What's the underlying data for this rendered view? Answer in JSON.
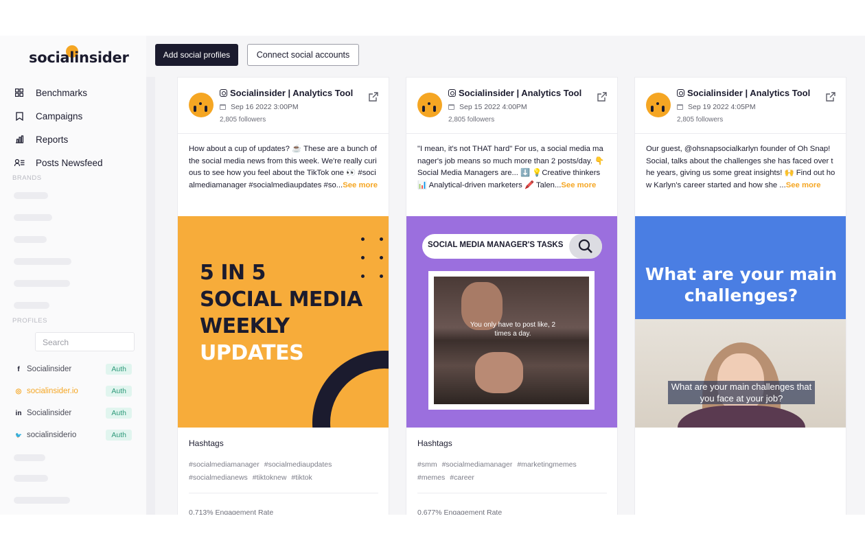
{
  "brand": {
    "logo_text": "socialinsider",
    "accent": "#f5a623",
    "dark": "#1b1b2e"
  },
  "nav": {
    "items": [
      {
        "label": "Benchmarks",
        "icon": "grid-icon"
      },
      {
        "label": "Campaigns",
        "icon": "bookmark-icon"
      },
      {
        "label": "Reports",
        "icon": "bar-chart-icon"
      },
      {
        "label": "Posts Newsfeed",
        "icon": "user-list-icon"
      }
    ]
  },
  "sections": {
    "brands": "BRANDS",
    "profiles": "PROFILES"
  },
  "search": {
    "placeholder": "Search"
  },
  "profiles": [
    {
      "icon": "f",
      "name": "Socialinsider",
      "badge": "Auth",
      "color": "#4b4c58"
    },
    {
      "icon": "◎",
      "name": "socialinsider.io",
      "badge": "Auth",
      "color": "#f5a623"
    },
    {
      "icon": "in",
      "name": "Socialinsider",
      "badge": "Auth",
      "color": "#4b4c58"
    },
    {
      "icon": "🐦",
      "name": "socialinsiderio",
      "badge": "Auth",
      "color": "#4b4c58"
    }
  ],
  "toolbar": {
    "add_profiles": "Add social profiles",
    "connect_accounts": "Connect social accounts"
  },
  "posts": [
    {
      "account": "Socialinsider | Analytics Tool",
      "date": "Sep 16 2022 3:00PM",
      "followers": "2,805 followers",
      "caption": "How about a cup of updates? ☕ These are a bunch of the social media news from this week. We're really curious to see how you feel about the TikTok one 👀 #socialmediamanager #socialmediaupdates #so...",
      "see_more": "See more",
      "hashtags_title": "Hashtags",
      "hashtags": [
        "#socialmediamanager",
        "#socialmediaupdates",
        "#socialmedianews",
        "#tiktoknew",
        "#tiktok"
      ],
      "engagement": "0.713% Engagement Rate",
      "media": {
        "line1": "5 IN 5",
        "line2": "SOCIAL MEDIA",
        "line3": "WEEKLY",
        "line4": "UPDATES"
      }
    },
    {
      "account": "Socialinsider | Analytics Tool",
      "date": "Sep 15 2022 4:00PM",
      "followers": "2,805 followers",
      "caption": "\"I mean, it's not THAT hard\" For us, a social media manager's job means so much more than 2 posts/day. 👇 Social Media Managers are... ⬇️ 💡Creative thinkers 📊 Analytical-driven marketers 🖍️ Talen...",
      "see_more": "See more",
      "hashtags_title": "Hashtags",
      "hashtags": [
        "#smm",
        "#socialmediamanager",
        "#marketingmemes",
        "#memes",
        "#career"
      ],
      "engagement": "0.677% Engagement Rate",
      "media": {
        "search_text": "SOCIAL MEDIA MANAGER'S TASKS",
        "meme_text": "You only have to post like, 2 times a day."
      }
    },
    {
      "account": "Socialinsider | Analytics Tool",
      "date": "Sep 19 2022 4:05PM",
      "followers": "2,805 followers",
      "caption": "Our guest, @ohsnapsocialkarlyn founder of Oh Snap! Social, talks about the challenges she has faced over the years, giving us some great insights! 🙌 Find out how Karlyn's career started and how she ...",
      "see_more": "See more",
      "media": {
        "question": "What are your main challenges?",
        "subtitle": "What are your main challenges that you face at your job?"
      }
    }
  ]
}
